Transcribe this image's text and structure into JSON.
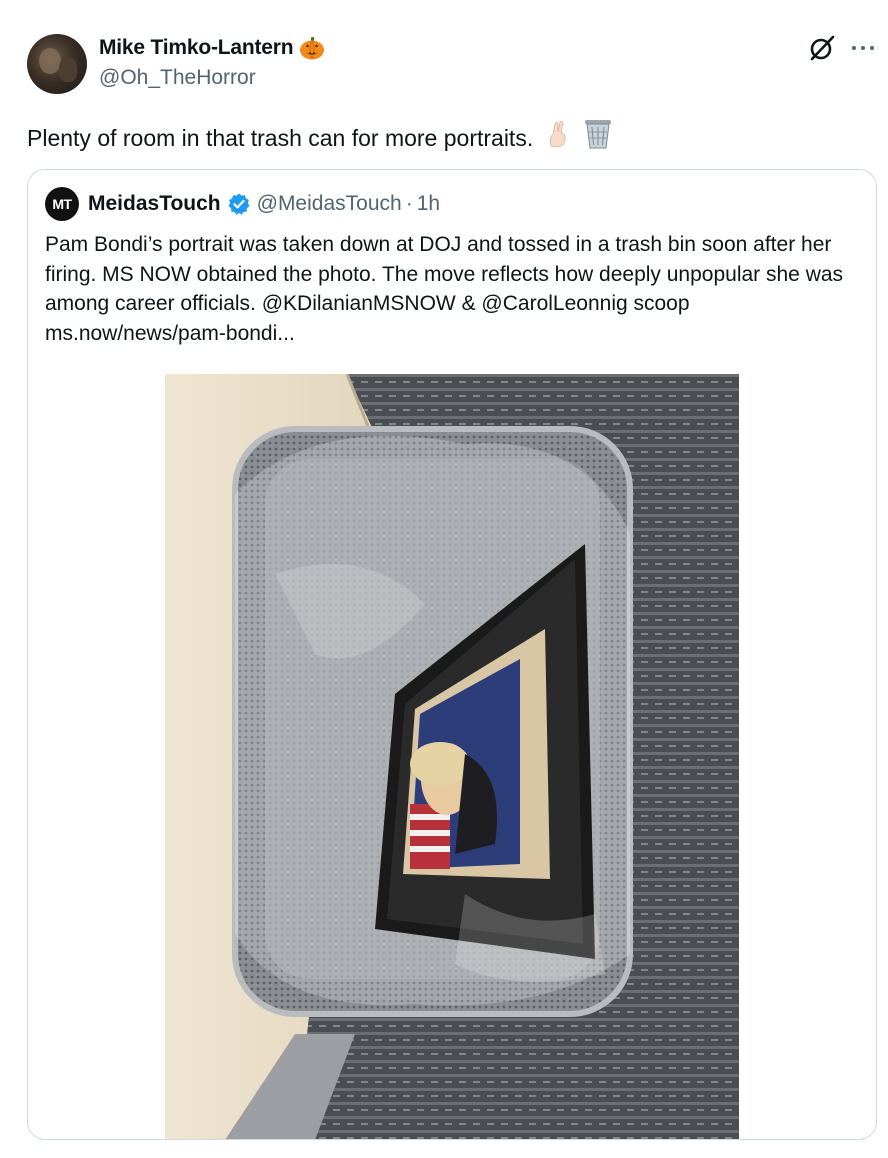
{
  "tweet": {
    "author_name": "Mike Timko-Lantern",
    "handle": "@Oh_TheHorror",
    "text": "Plenty of room in that trash can for more portraits.",
    "icons": [
      "pumpkin-emoji",
      "crossed-fingers-emoji",
      "wastebasket-emoji",
      "grok-icon",
      "more-icon"
    ]
  },
  "quote": {
    "avatar_initials": "MT",
    "name": "MeidasTouch",
    "handle": "@MeidasTouch",
    "separator": "·",
    "time": "1h",
    "text": "Pam Bondi’s portrait was taken down at DOJ and tossed in a trash bin soon after her firing. MS NOW obtained the photo. The move reflects how deeply unpopular she was among career officials. @KDilanianMSNOW & @CarolLeonnig scoop ms.now/news/pam-bondi...",
    "verified_color": "#1d9bf0"
  }
}
